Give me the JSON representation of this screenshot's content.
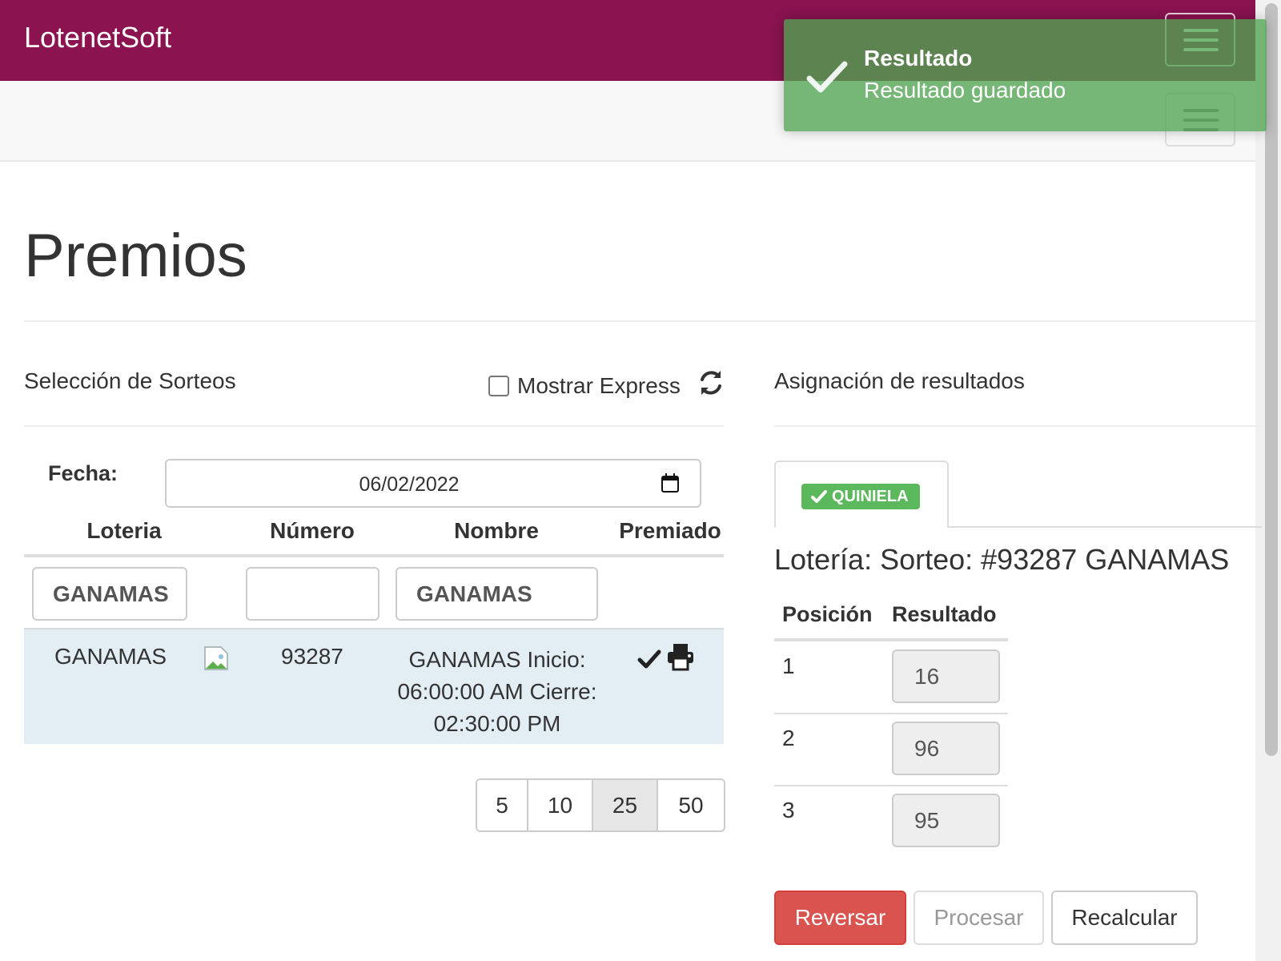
{
  "navbar": {
    "brand": "LotenetSoft"
  },
  "page": {
    "title": "Premios"
  },
  "left_panel": {
    "heading": "Selección de Sorteos",
    "express_label": "Mostrar Express",
    "express_checked": false,
    "fecha_label": "Fecha:",
    "fecha_value": "06/02/2022",
    "columns": [
      "Loteria",
      "Número",
      "Nombre",
      "Premiado"
    ],
    "filters": {
      "loteria": "GANAMAS",
      "numero": "",
      "nombre": "GANAMAS"
    },
    "rows": [
      {
        "loteria": "GANAMAS",
        "numero": "93287",
        "nombre_line1": "GANAMAS Inicio:",
        "nombre_line2": "06:00:00 AM Cierre:",
        "nombre_line3": "02:30:00 PM",
        "premiado_icon": "check-icon",
        "print_icon": "print-icon"
      }
    ],
    "page_sizes": [
      "5",
      "10",
      "25",
      "50"
    ],
    "active_page_size": "25"
  },
  "right_panel": {
    "heading": "Asignación de resultados",
    "tab_label": "QUINIELA",
    "sorteo_title": "Lotería: Sorteo: #93287 GANAMAS",
    "columns": [
      "Posición",
      "Resultado"
    ],
    "results": [
      {
        "posicion": "1",
        "resultado": "16"
      },
      {
        "posicion": "2",
        "resultado": "96"
      },
      {
        "posicion": "3",
        "resultado": "95"
      }
    ],
    "buttons": {
      "reversar": "Reversar",
      "procesar": "Procesar",
      "recalcular": "Recalcular"
    }
  },
  "toast": {
    "title": "Resultado",
    "message": "Resultado guardado",
    "icon": "check-icon"
  },
  "colors": {
    "navbar": "#8a1350",
    "toast": "#51a351",
    "danger": "#d9534f",
    "badge": "#5cb85c"
  }
}
